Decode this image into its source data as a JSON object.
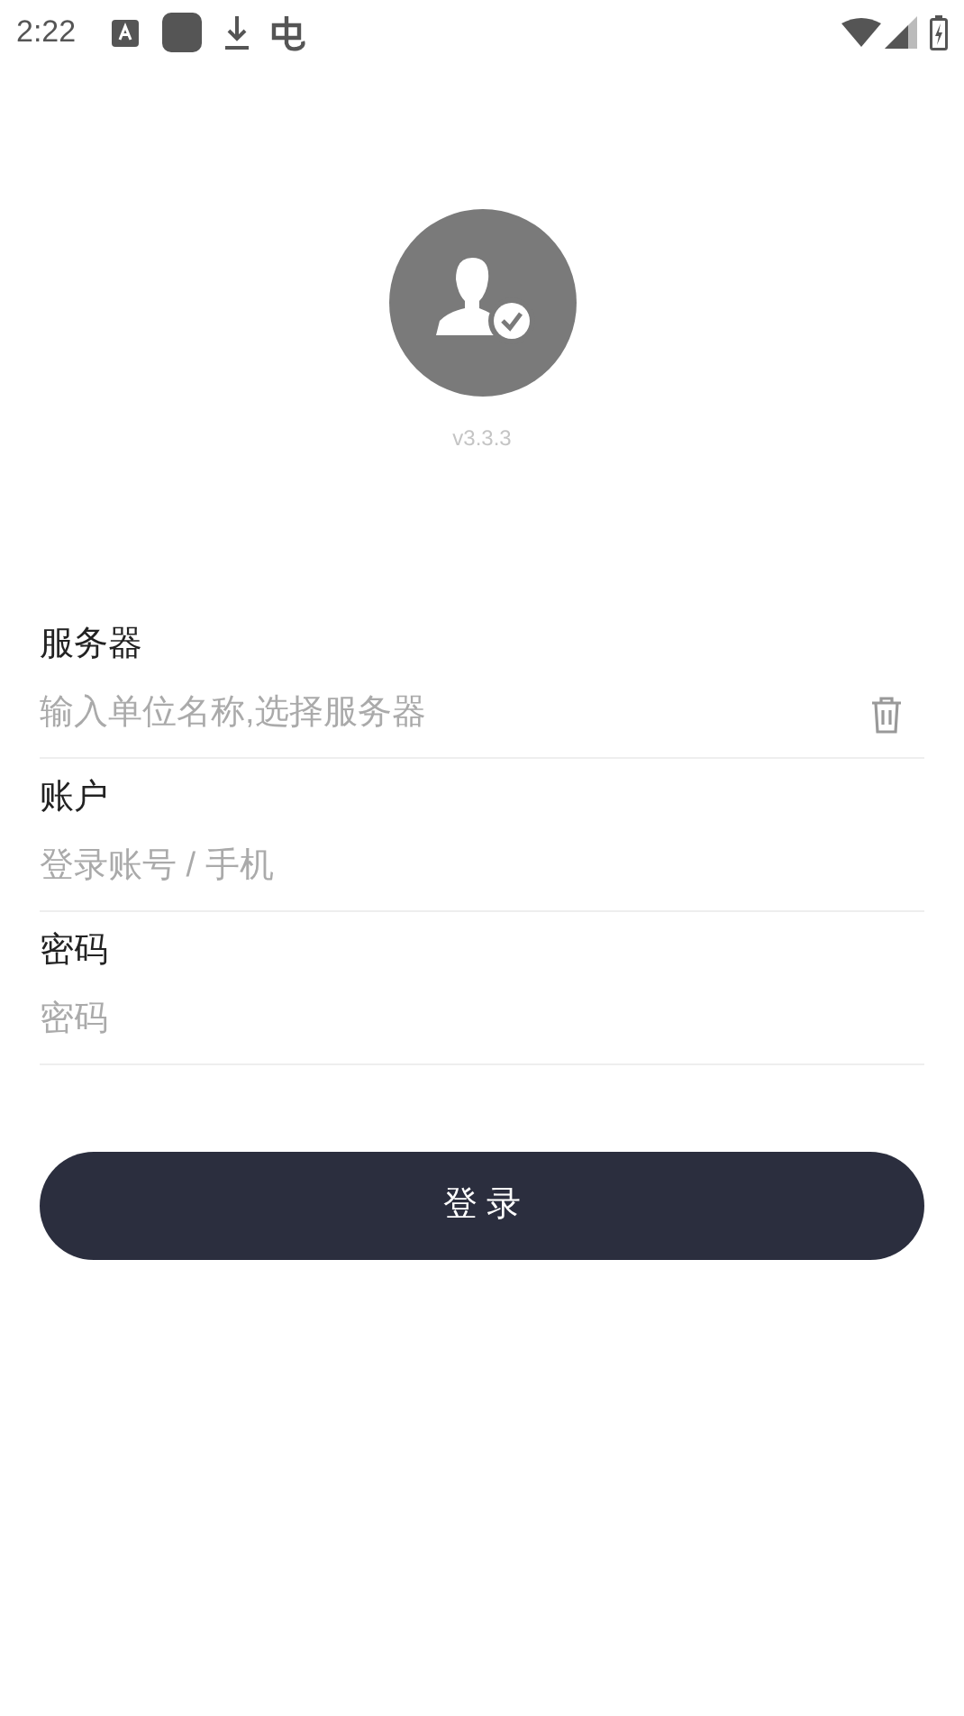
{
  "status_bar": {
    "time": "2:22"
  },
  "version": "v3.3.3",
  "fields": [
    {
      "label": "服务器",
      "placeholder": "输入单位名称,选择服务器",
      "kind": "clearable"
    },
    {
      "label": "账户",
      "placeholder": "登录账号 / 手机",
      "kind": "plain"
    },
    {
      "label": "密码",
      "placeholder": "密码",
      "kind": "plain"
    }
  ],
  "login_button": "登 录"
}
